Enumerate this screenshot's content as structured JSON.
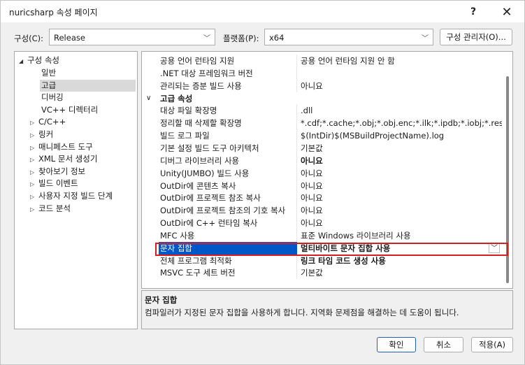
{
  "window": {
    "title": "nuricsharp 속성 페이지",
    "help_glyph": "?",
    "close_glyph": "✕"
  },
  "config": {
    "config_label": "구성(C):",
    "config_value": "Release",
    "platform_label": "플랫폼(P):",
    "platform_value": "x64",
    "manager_button": "구성 관리자(O)..."
  },
  "tree": {
    "root": "구성 속성",
    "children": [
      {
        "label": "일반",
        "expandable": false
      },
      {
        "label": "고급",
        "expandable": false,
        "selected": true
      },
      {
        "label": "디버깅",
        "expandable": false
      },
      {
        "label": "VC++ 디렉터리",
        "expandable": false
      },
      {
        "label": "C/C++",
        "expandable": true
      },
      {
        "label": "링커",
        "expandable": true
      },
      {
        "label": "매니페스트 도구",
        "expandable": true
      },
      {
        "label": "XML 문서 생성기",
        "expandable": true
      },
      {
        "label": "찾아보기 정보",
        "expandable": true
      },
      {
        "label": "빌드 이벤트",
        "expandable": true
      },
      {
        "label": "사용자 지정 빌드 단계",
        "expandable": true
      },
      {
        "label": "코드 분석",
        "expandable": true
      }
    ]
  },
  "grid": {
    "rows": [
      {
        "name": "공용 언어 런타임 지원",
        "value": "공용 언어 런타임 지원 안 함"
      },
      {
        "name": ".NET 대상 프레임워크 버전",
        "value": ""
      },
      {
        "name": "관리되는 증분 빌드 사용",
        "value": "아니요"
      },
      {
        "category": true,
        "name": "고급 속성"
      },
      {
        "name": "대상 파일 확장명",
        "value": ".dll"
      },
      {
        "name": "정리할 때 삭제할 확장명",
        "value": "*.cdf;*.cache;*.obj;*.obj.enc;*.ilk;*.ipdb;*.iobj;*.resources;*.tlb;*.tli;*.tlh;*.tmp;*.rsp;*.pgc;*.pgd;*.meta;*.tlog;*.manifest;*.res;*.pch;*.exp;*.idb;*.rep;*.xdc;*.pdb;*_manifest.rc;*.bsc;*.sbr;*.xml;*.metagen;*.bi"
      },
      {
        "name": "빌드 로그 파일",
        "value": "$(IntDir)$(MSBuildProjectName).log"
      },
      {
        "name": "기본 설정 빌드 도구 아키텍처",
        "value": "기본값"
      },
      {
        "name": "디버그 라이브러리 사용",
        "value": "아니요",
        "bold": true
      },
      {
        "name": "Unity(JUMBO) 빌드 사용",
        "value": "아니요"
      },
      {
        "name": "OutDir에 콘텐츠 복사",
        "value": "아니요"
      },
      {
        "name": "OutDir에 프로젝트 참조 복사",
        "value": "아니요"
      },
      {
        "name": "OutDir에 프로젝트 참조의 기호 복사",
        "value": "아니요"
      },
      {
        "name": "OutDir에 C++ 런타임 복사",
        "value": "아니요"
      },
      {
        "name": "MFC 사용",
        "value": "표준 Windows 라이브러리 사용"
      },
      {
        "name": "문자 집합",
        "value": "멀티바이트 문자 집합 사용",
        "selected": true,
        "bold": true
      },
      {
        "name": "전체 프로그램 최적화",
        "value": "링크 타임 코드 생성 사용",
        "bold": true
      },
      {
        "name": "MSVC 도구 세트 버전",
        "value": "기본값"
      }
    ]
  },
  "description": {
    "title": "문자 집합",
    "text": "컴파일러가 지정된 문자 집합을 사용하게 합니다. 지역화 문제점을 해결하는 데 도움이 됩니다."
  },
  "buttons": {
    "ok": "확인",
    "cancel": "취소",
    "apply": "적용(A)"
  },
  "icons": {
    "dropdown": "chevron-down-icon",
    "expanded": "triangle-down-icon",
    "collapsed": "triangle-right-icon",
    "category": "chevron-down-icon"
  },
  "colors": {
    "selection": "#0057c8",
    "highlight_box": "#d22020",
    "primary_border": "#1f5fbf"
  }
}
